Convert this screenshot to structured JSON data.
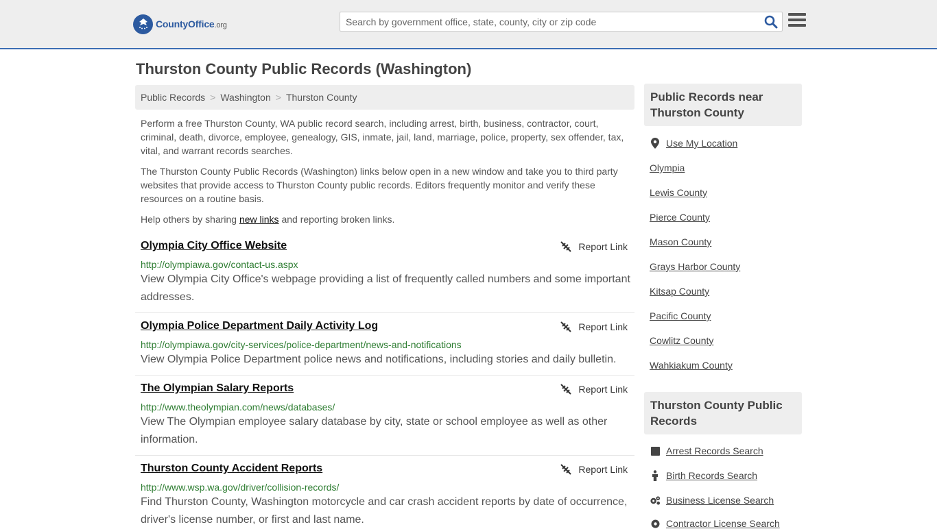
{
  "header": {
    "logo": {
      "brand": "CountyOffice",
      "tld": ".org"
    },
    "search": {
      "placeholder": "Search by government office, state, county, city or zip code"
    }
  },
  "page": {
    "title": "Thurston County Public Records (Washington)"
  },
  "breadcrumb": {
    "items": [
      "Public Records",
      "Washington",
      "Thurston County"
    ],
    "separator": ">"
  },
  "intro": {
    "paragraph1": "Perform a free Thurston County, WA public record search, including arrest, birth, business, contractor, court, criminal, death, divorce, employee, genealogy, GIS, inmate, jail, land, marriage, police, property, sex offender, tax, vital, and warrant records searches.",
    "paragraph2": "The Thurston County Public Records (Washington) links below open in a new window and take you to third party websites that provide access to Thurston County public records. Editors frequently monitor and verify these resources on a routine basis.",
    "help_before": "Help others by sharing ",
    "help_link": "new links",
    "help_after": " and reporting broken links."
  },
  "report_label": "Report Link",
  "records": [
    {
      "title": "Olympia City Office Website",
      "url": "http://olympiawa.gov/contact-us.aspx",
      "description": "View Olympia City Office's webpage providing a list of frequently called numbers and some important addresses."
    },
    {
      "title": "Olympia Police Department Daily Activity Log",
      "url": "http://olympiawa.gov/city-services/police-department/news-and-notifications",
      "description": "View Olympia Police Department police news and notifications, including stories and daily bulletin."
    },
    {
      "title": "The Olympian Salary Reports",
      "url": "http://www.theolympian.com/news/databases/",
      "description": "View The Olympian employee salary database by city, state or school employee as well as other information."
    },
    {
      "title": "Thurston County Accident Reports",
      "url": "http://www.wsp.wa.gov/driver/collision-records/",
      "description": "Find Thurston County, Washington motorcycle and car crash accident reports by date of occurrence, driver's license number, or first and last name."
    }
  ],
  "sidebar": {
    "nearby_title": "Public Records near Thurston County",
    "use_location": "Use My Location",
    "nearby": [
      "Olympia",
      "Lewis County",
      "Pierce County",
      "Mason County",
      "Grays Harbor County",
      "Kitsap County",
      "Pacific County",
      "Cowlitz County",
      "Wahkiakum County"
    ],
    "county_title": "Thurston County Public Records",
    "county_links": [
      {
        "label": "Arrest Records Search",
        "icon": "square-icon"
      },
      {
        "label": "Birth Records Search",
        "icon": "person-icon"
      },
      {
        "label": "Business License Search",
        "icon": "gears-icon"
      },
      {
        "label": "Contractor License Search",
        "icon": "gear-icon"
      }
    ]
  }
}
